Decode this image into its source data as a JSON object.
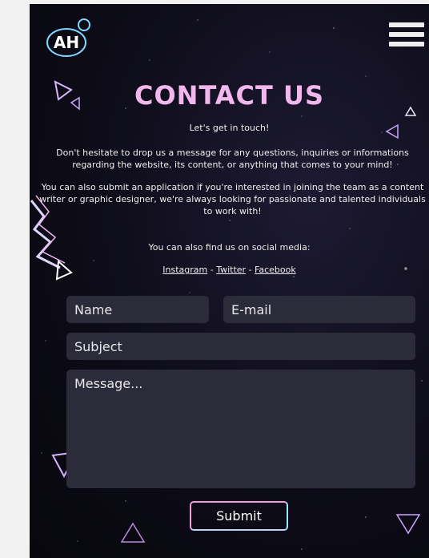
{
  "brand": {
    "logo_text": "AH"
  },
  "header": {
    "title": "CONTACT US",
    "subtitle": "Let's get in touch!"
  },
  "content": {
    "paragraph1": "Don't hesitate to drop us a message for any questions, inquiries or informations regarding the website, its content, or anything that comes to your mind!",
    "paragraph2": "You can also submit an application if you're interested in joining the team as a content writer or graphic designer, we're always looking for passionate and talented individuals to work with!",
    "social_label": "You can also find us on social media:",
    "social_links": [
      {
        "label": "Instagram"
      },
      {
        "label": "Twitter"
      },
      {
        "label": "Facebook"
      }
    ],
    "social_separator": " - "
  },
  "form": {
    "name_placeholder": "Name",
    "email_placeholder": "E-mail",
    "subject_placeholder": "Subject",
    "message_placeholder": "Message...",
    "submit_label": "Submit"
  },
  "colors": {
    "title": "#f2b8ee",
    "field_bg": "#2b2b3a",
    "submit_border_pink": "#f29bd8",
    "submit_border_cyan": "#9ee4ff",
    "background": "#0d0c18"
  },
  "icons": [
    "logo-icon",
    "hamburger-menu-icon",
    "triangle-decor-icon",
    "lightning-arrow-icon"
  ]
}
